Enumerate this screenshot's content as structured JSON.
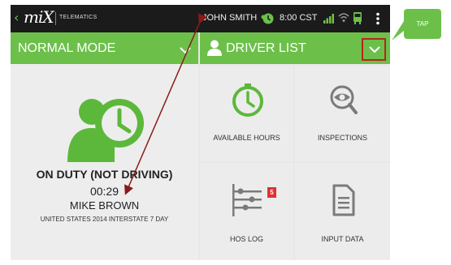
{
  "statusbar": {
    "back_icon": "chevron-left-icon",
    "logo_text": "miX",
    "logo_sub": "TELEMATICS",
    "user_name": "JOHN SMITH",
    "time": "8:00 CST",
    "icons": [
      "clock-icon",
      "signal-icon",
      "wifi-icon",
      "truck-icon",
      "more-vertical-icon"
    ]
  },
  "mode_bar": {
    "label": "NORMAL MODE",
    "icon": "chevron-down-icon"
  },
  "driver_bar": {
    "label": "DRIVER LIST",
    "icon": "person-icon",
    "dropdown_icon": "chevron-down-icon"
  },
  "duty_status": {
    "title": "ON DUTY (NOT DRIVING)",
    "elapsed": "00:29",
    "driver_name": "MIKE BROWN",
    "ruleset": "UNITED STATES 2014 INTERSTATE 7 DAY",
    "icon": "driver-clock-icon"
  },
  "tiles": [
    {
      "label": "AVAILABLE HOURS",
      "icon": "clock-icon"
    },
    {
      "label": "INSPECTIONS",
      "icon": "eye-search-icon"
    },
    {
      "label": "HOS LOG",
      "icon": "hos-log-icon",
      "badge": "5"
    },
    {
      "label": "INPUT DATA",
      "icon": "document-icon"
    }
  ],
  "annotation": {
    "label": "TAP"
  },
  "colors": {
    "accent_green": "#6cc04a",
    "status_bar": "#1b1b1b",
    "icon_green": "#5cb83a",
    "highlight_red": "#b3261e",
    "arrow": "#8b1a1a",
    "badge_red": "#e03131"
  }
}
